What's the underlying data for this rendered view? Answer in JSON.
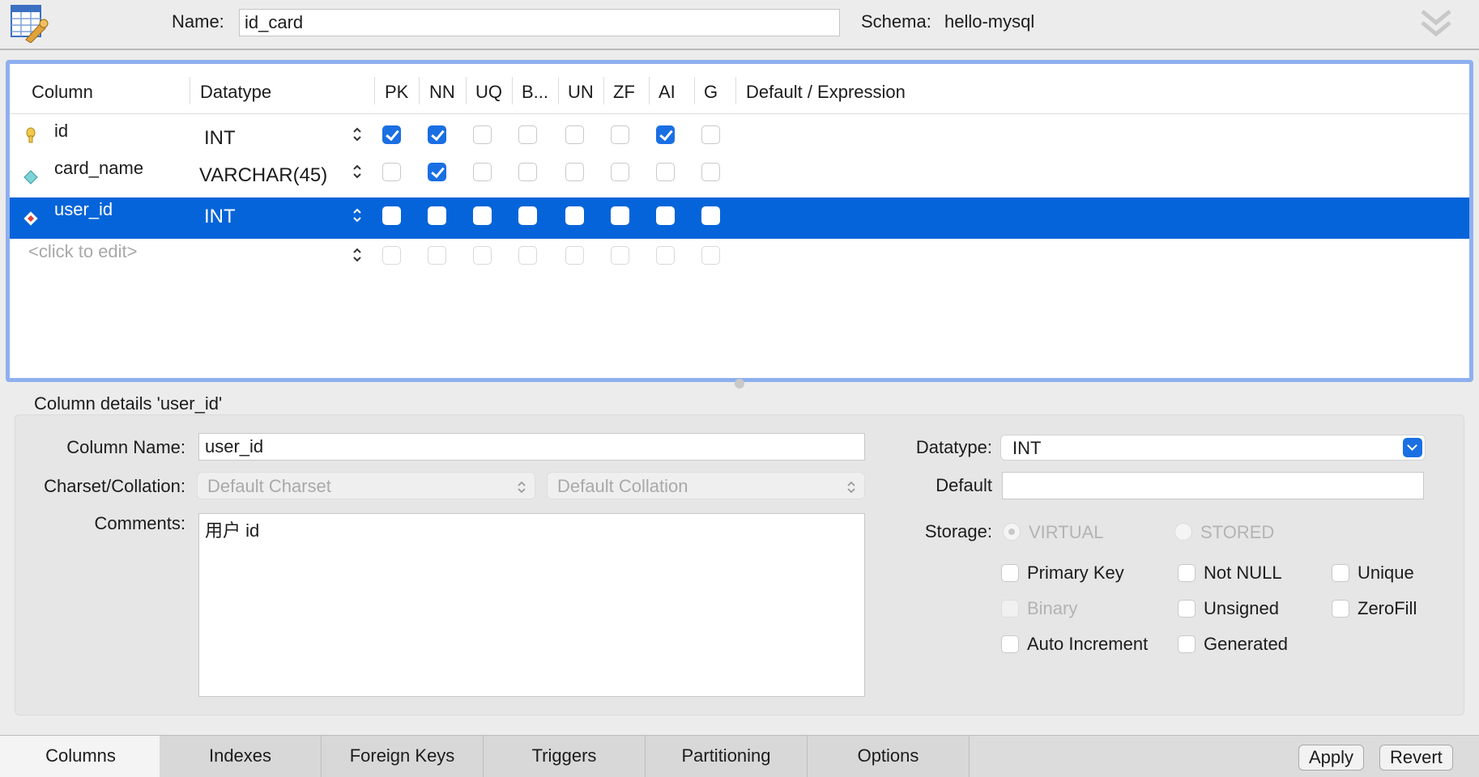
{
  "header": {
    "name_label": "Name:",
    "name_value": "id_card",
    "schema_label": "Schema:",
    "schema_value": "hello-mysql"
  },
  "grid": {
    "headers": [
      "Column",
      "Datatype",
      "PK",
      "NN",
      "UQ",
      "B...",
      "UN",
      "ZF",
      "AI",
      "G",
      "Default / Expression"
    ],
    "rows": [
      {
        "name": "id",
        "type": "INT",
        "flags": [
          true,
          true,
          false,
          false,
          false,
          false,
          true,
          false
        ],
        "icon": "primary-key-icon"
      },
      {
        "name": "card_name",
        "type": "VARCHAR(45)",
        "flags": [
          false,
          true,
          false,
          false,
          false,
          false,
          false,
          false
        ],
        "icon": "column-diamond-icon"
      },
      {
        "name": "user_id",
        "type": "INT",
        "flags": [
          false,
          false,
          false,
          false,
          false,
          false,
          false,
          false
        ],
        "icon": "foreign-key-diamond-icon",
        "selected": true
      }
    ],
    "placeholder_row": "<click to edit>"
  },
  "details": {
    "title": "Column details 'user_id'",
    "column_name_label": "Column Name:",
    "column_name_value": "user_id",
    "charset_label": "Charset/Collation:",
    "charset_value": "Default Charset",
    "collation_value": "Default Collation",
    "comments_label": "Comments:",
    "comments_value": "用户 id",
    "datatype_label": "Datatype:",
    "datatype_value": "INT",
    "default_label": "Default",
    "default_value": "",
    "storage_label": "Storage:",
    "storage_virtual": "VIRTUAL",
    "storage_stored": "STORED",
    "options": {
      "primary_key": "Primary Key",
      "not_null": "Not NULL",
      "unique": "Unique",
      "binary": "Binary",
      "unsigned": "Unsigned",
      "zerofill": "ZeroFill",
      "auto_increment": "Auto Increment",
      "generated": "Generated"
    }
  },
  "tabs": [
    "Columns",
    "Indexes",
    "Foreign Keys",
    "Triggers",
    "Partitioning",
    "Options"
  ],
  "active_tab": "Columns",
  "buttons": {
    "apply": "Apply",
    "revert": "Revert"
  },
  "colors": {
    "selection": "#0564d9",
    "accent": "#1a6fe3",
    "grid_border": "#8eb0ef"
  }
}
